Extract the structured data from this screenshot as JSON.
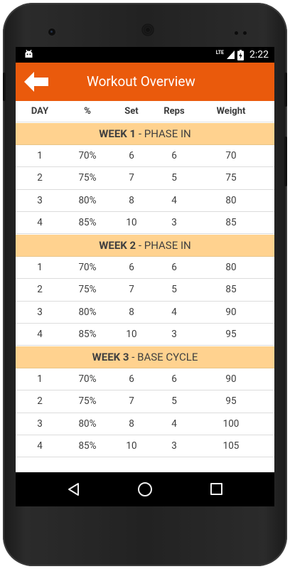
{
  "status_bar": {
    "network": "LTE",
    "time": "2:22"
  },
  "app_bar": {
    "title": "Workout Overview",
    "back_icon": "arrow-left-icon"
  },
  "table": {
    "columns": [
      "DAY",
      "%",
      "Set",
      "Reps",
      "Weight"
    ]
  },
  "weeks": [
    {
      "label": "WEEK 1",
      "phase": " - PHASE IN",
      "rows": [
        [
          "1",
          "70%",
          "6",
          "6",
          "70"
        ],
        [
          "2",
          "75%",
          "7",
          "5",
          "75"
        ],
        [
          "3",
          "80%",
          "8",
          "4",
          "80"
        ],
        [
          "4",
          "85%",
          "10",
          "3",
          "85"
        ]
      ]
    },
    {
      "label": "WEEK 2",
      "phase": " - PHASE IN",
      "rows": [
        [
          "1",
          "70%",
          "6",
          "6",
          "80"
        ],
        [
          "2",
          "75%",
          "7",
          "5",
          "85"
        ],
        [
          "3",
          "80%",
          "8",
          "4",
          "90"
        ],
        [
          "4",
          "85%",
          "10",
          "3",
          "95"
        ]
      ]
    },
    {
      "label": "WEEK 3",
      "phase": " - BASE CYCLE",
      "rows": [
        [
          "1",
          "70%",
          "6",
          "6",
          "90"
        ],
        [
          "2",
          "75%",
          "7",
          "5",
          "95"
        ],
        [
          "3",
          "80%",
          "8",
          "4",
          "100"
        ],
        [
          "4",
          "85%",
          "10",
          "3",
          "105"
        ]
      ]
    }
  ],
  "colors": {
    "app_bar": "#ea5a0c",
    "week_header": "#ffd28f",
    "status_bar": "#000000"
  }
}
